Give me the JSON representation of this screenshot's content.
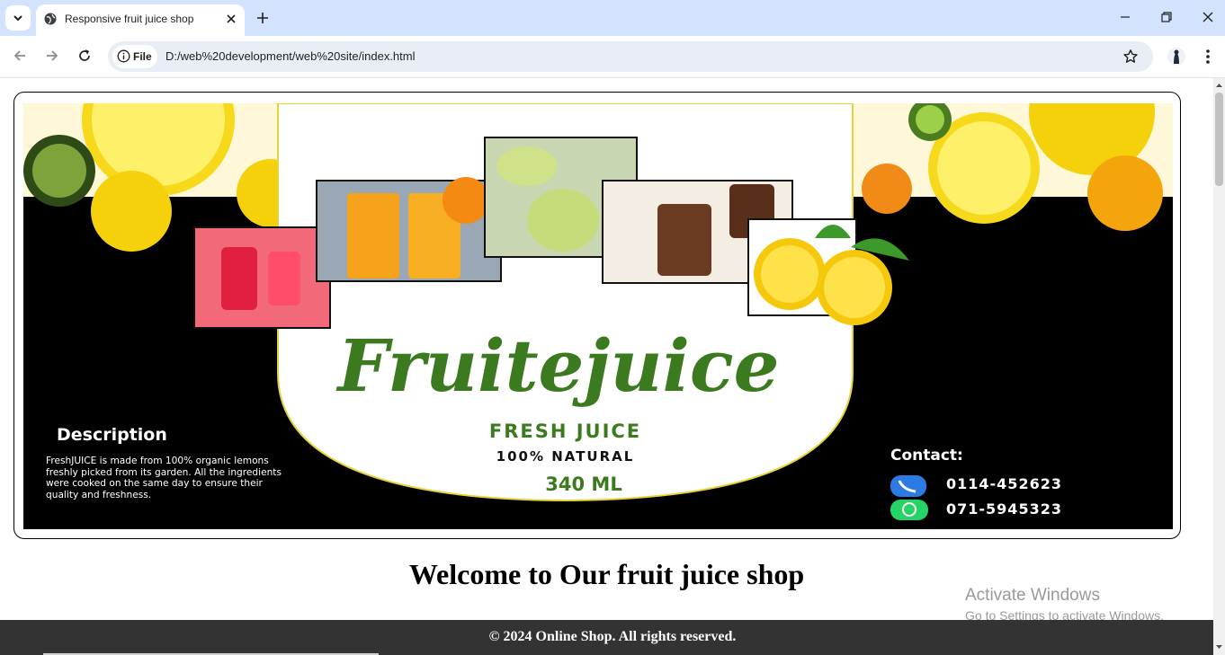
{
  "browser": {
    "tab_title": "Responsive fruit juice shop",
    "file_chip": "File",
    "url": "D:/web%20development/web%20site/index.html"
  },
  "banner": {
    "brand": "Fruitejuice",
    "tagline": "FRESH JUICE",
    "natural": "100% NATURAL",
    "volume": "340 ML",
    "description_title": "Description",
    "description_lines": [
      "FreshJUICE is made from 100% organic lemons",
      "freshly picked from its garden. All the ingredients",
      "were cooked on the same day to ensure their",
      "quality and freshness."
    ],
    "contact_title": "Contact:",
    "phone": "0114-452623",
    "whatsapp": "071-5945323"
  },
  "page": {
    "heading": "Welcome to Our fruit juice shop",
    "footer": "© 2024 Online Shop. All rights reserved."
  },
  "watermark": {
    "title": "Activate Windows",
    "subtitle": "Go to Settings to activate Windows."
  },
  "colors": {
    "brand_green": "#3b7a1e",
    "lemon": "#f5d90a",
    "tabstrip": "#d3e3fd"
  }
}
